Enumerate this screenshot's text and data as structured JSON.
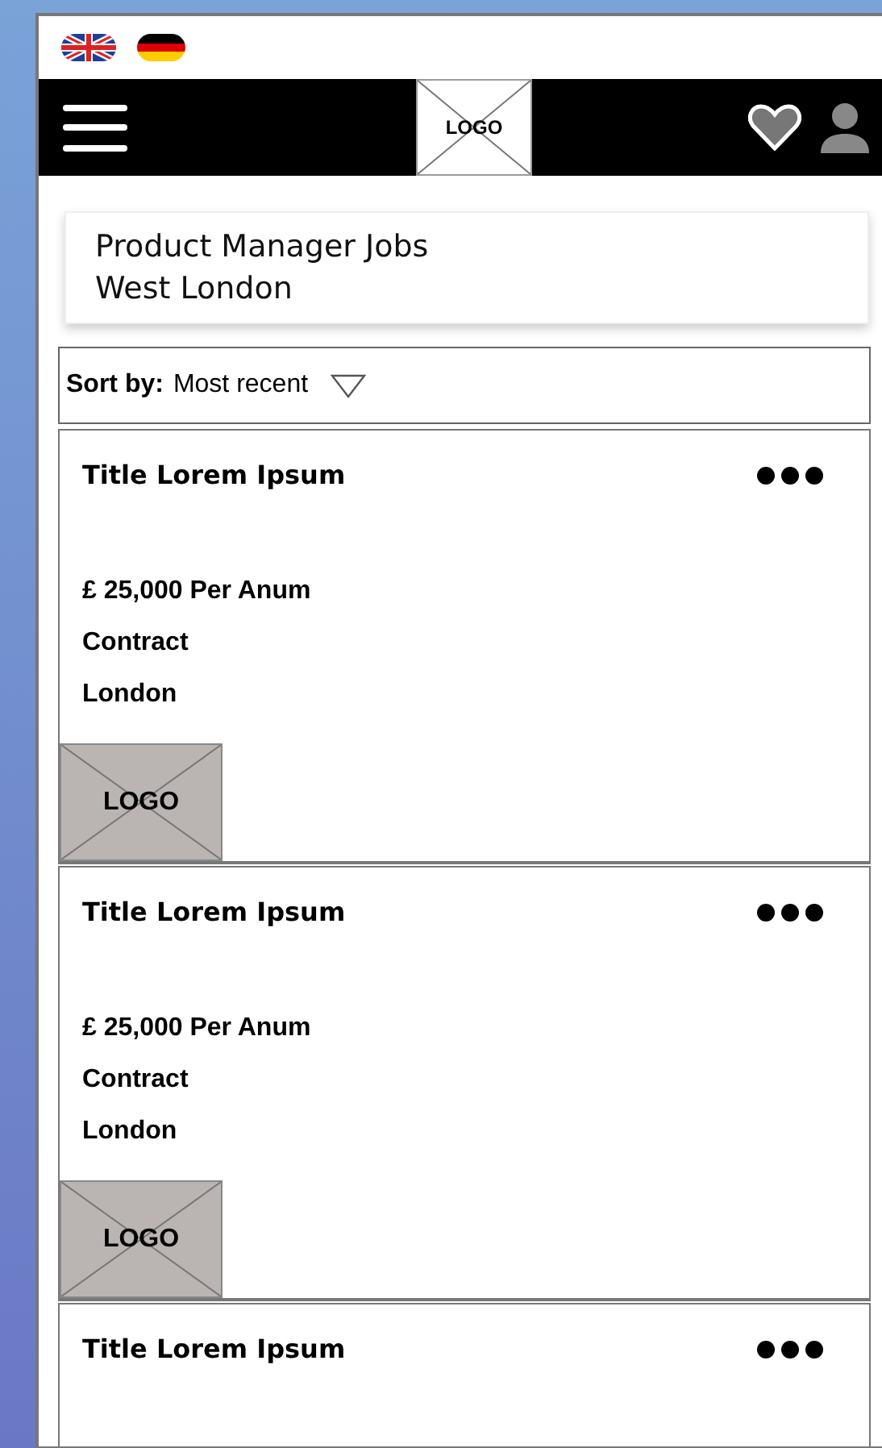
{
  "languages": [
    {
      "kind": "uk"
    },
    {
      "kind": "de"
    }
  ],
  "header": {
    "logo": "LOGO"
  },
  "search": {
    "lines": [
      "Product Manager Jobs",
      "West London"
    ]
  },
  "sort": {
    "label": "Sort by:",
    "value": "Most recent"
  },
  "jobs": [
    {
      "title": "Title Lorem Ipsum",
      "salary": "£ 25,000 Per Anum",
      "type": "Contract",
      "location": "London",
      "logo": "LOGO"
    },
    {
      "title": "Title Lorem Ipsum",
      "salary": "£ 25,000 Per Anum",
      "type": "Contract",
      "location": "London",
      "logo": "LOGO"
    },
    {
      "title": "Title Lorem Ipsum"
    }
  ]
}
